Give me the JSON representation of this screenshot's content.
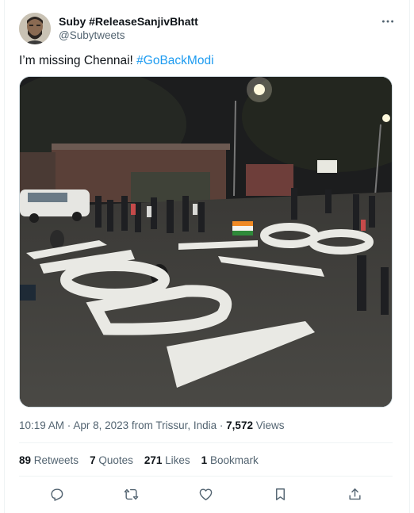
{
  "tweet": {
    "author": {
      "display_name": "Suby #ReleaseSanjivBhatt",
      "handle": "@Subytweets"
    },
    "text_plain": "I’m missing Chennai! ",
    "hashtag": "#GoBackModi",
    "media": {
      "painted_text": [
        "GO",
        "BACK",
        "MODI"
      ],
      "colors": {
        "road": "#3c3b38",
        "paint": "#e9e9e4",
        "sky": "#1c1d1e"
      }
    },
    "meta": {
      "time": "10:19 AM",
      "separator": " · ",
      "date": "Apr 8, 2023",
      "location": " from Trissur, India",
      "views_count": "7,572",
      "views_label": " Views"
    },
    "stats": {
      "retweets": {
        "count": "89",
        "label": " Retweets"
      },
      "quotes": {
        "count": "7",
        "label": " Quotes"
      },
      "likes": {
        "count": "271",
        "label": " Likes"
      },
      "bookmarks": {
        "count": "1",
        "label": " Bookmark"
      }
    },
    "actions": [
      "reply-icon",
      "retweet-icon",
      "like-icon",
      "bookmark-icon",
      "share-icon"
    ]
  },
  "theme": {
    "accent": "#1d9bf0",
    "text": "#0f1419",
    "muted": "#536471",
    "border": "#eff3f4"
  }
}
